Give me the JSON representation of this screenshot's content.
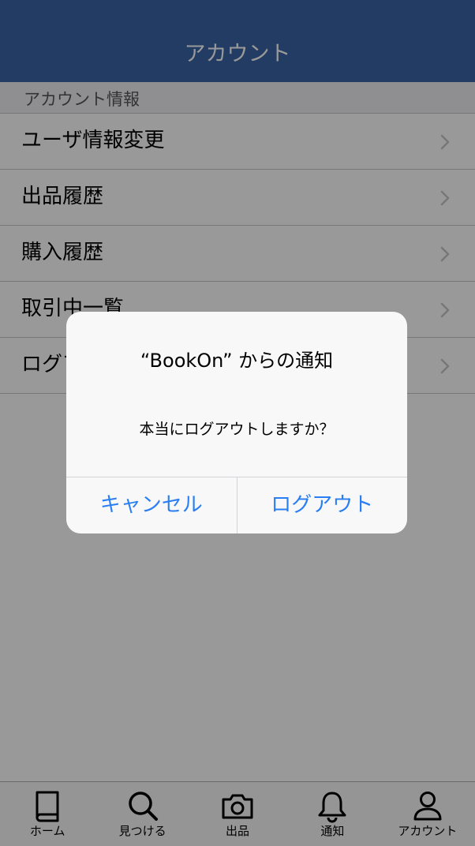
{
  "header": {
    "title": "アカウント"
  },
  "section": {
    "label": "アカウント情報"
  },
  "menu": [
    {
      "label": "ユーザ情報変更"
    },
    {
      "label": "出品履歴"
    },
    {
      "label": "購入履歴"
    },
    {
      "label": "取引中一覧"
    },
    {
      "label": "ログアウト"
    }
  ],
  "tabbar": {
    "items": [
      {
        "label": "ホーム",
        "icon": "book-icon"
      },
      {
        "label": "見つける",
        "icon": "search-icon"
      },
      {
        "label": "出品",
        "icon": "camera-icon"
      },
      {
        "label": "通知",
        "icon": "bell-icon"
      },
      {
        "label": "アカウント",
        "icon": "person-icon"
      }
    ]
  },
  "dialog": {
    "title": "“BookOn” からの通知",
    "message": "本当にログアウトしますか？",
    "cancel_label": "キャンセル",
    "logout_label": "ログアウト"
  },
  "colors": {
    "header_bg": "#3a64a6",
    "accent": "#2a7ef3",
    "overlay": "rgba(0,0,0,0.40)"
  }
}
